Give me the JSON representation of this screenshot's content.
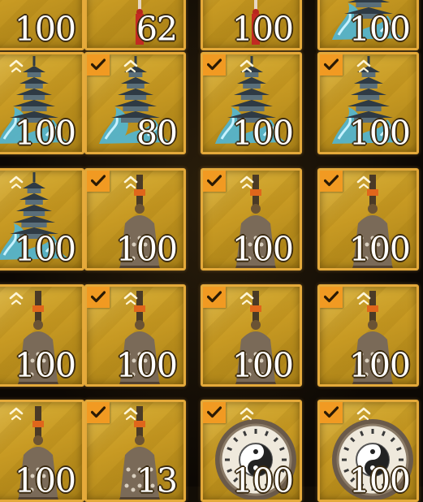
{
  "inventory": {
    "rows": [
      {
        "items": [
          {
            "item": "unknown-item",
            "count": "100",
            "selected": false,
            "rank_marker": false
          },
          {
            "item": "red-tassel",
            "count": "62",
            "selected": false,
            "rank_marker": false
          },
          {
            "item": "red-tassel",
            "count": "100",
            "selected": false,
            "rank_marker": false
          },
          {
            "item": "pagoda-on-waves",
            "count": "100",
            "selected": false,
            "rank_marker": false
          }
        ]
      },
      {
        "items": [
          {
            "item": "pagoda-on-waves",
            "count": "100",
            "selected": false,
            "rank_marker": true
          },
          {
            "item": "pagoda-on-waves",
            "count": "80",
            "selected": true,
            "rank_marker": true
          },
          {
            "item": "pagoda-on-waves",
            "count": "100",
            "selected": true,
            "rank_marker": true
          },
          {
            "item": "pagoda-on-waves",
            "count": "100",
            "selected": true,
            "rank_marker": true
          }
        ]
      },
      {
        "items": [
          {
            "item": "pagoda-on-waves",
            "count": "100",
            "selected": false,
            "rank_marker": true
          },
          {
            "item": "bronze-bell",
            "count": "100",
            "selected": true,
            "rank_marker": true
          },
          {
            "item": "bronze-bell",
            "count": "100",
            "selected": true,
            "rank_marker": true
          },
          {
            "item": "bronze-bell",
            "count": "100",
            "selected": true,
            "rank_marker": true
          }
        ]
      },
      {
        "items": [
          {
            "item": "bronze-bell",
            "count": "100",
            "selected": false,
            "rank_marker": true
          },
          {
            "item": "bronze-bell",
            "count": "100",
            "selected": true,
            "rank_marker": true
          },
          {
            "item": "bronze-bell",
            "count": "100",
            "selected": true,
            "rank_marker": true
          },
          {
            "item": "bronze-bell",
            "count": "100",
            "selected": true,
            "rank_marker": true
          }
        ]
      },
      {
        "items": [
          {
            "item": "bronze-bell",
            "count": "100",
            "selected": false,
            "rank_marker": true
          },
          {
            "item": "bronze-bell",
            "count": "13",
            "selected": true,
            "rank_marker": true
          },
          {
            "item": "bagua-compass",
            "count": "100",
            "selected": true,
            "rank_marker": true
          },
          {
            "item": "bagua-compass",
            "count": "100",
            "selected": true,
            "rank_marker": true
          }
        ]
      }
    ]
  },
  "colors": {
    "slot_border": "#e4a93a",
    "slot_fill": "#c89a23",
    "check_badge": "#f19a22",
    "count_text": "#ffffff"
  }
}
